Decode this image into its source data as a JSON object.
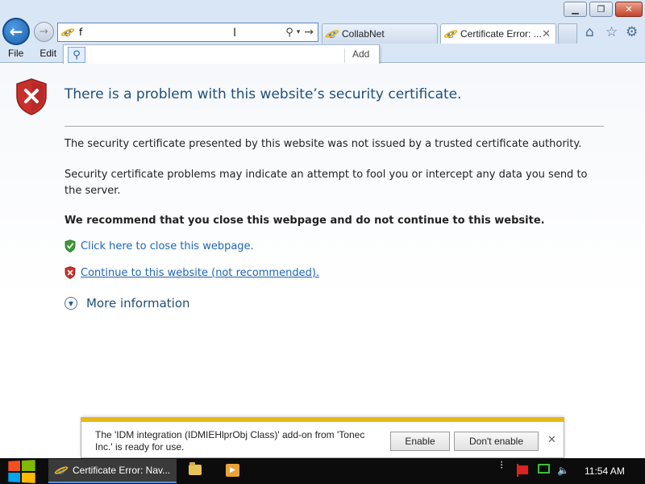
{
  "window": {
    "minimize_glyph": "▁",
    "maximize_glyph": "❐",
    "close_glyph": "✕"
  },
  "nav": {
    "back_glyph": "←",
    "forward_glyph": "→"
  },
  "address_bar": {
    "value": "f",
    "search_glyph": "⚲",
    "dropdown_glyph": "▾",
    "go_glyph": "→",
    "cursor_glyph": "I"
  },
  "tabs": [
    {
      "label": "CollabNet",
      "icon": "ie-icon"
    },
    {
      "label": "Certificate Error: ...",
      "icon": "ie-icon",
      "close_glyph": "✕"
    }
  ],
  "toolbar_icons": {
    "home_glyph": "⌂",
    "favorites_glyph": "☆",
    "tools_glyph": "⚙"
  },
  "menu": [
    "File",
    "Edit"
  ],
  "suggestion": {
    "search_glyph": "⚲",
    "add_label": "Add"
  },
  "page": {
    "headline": "There is a problem with this website’s security certificate.",
    "para1": "The security certificate presented by this website was not issued by a trusted certificate authority.",
    "para2": "Security certificate problems may indicate an attempt to fool you or intercept any data you send to the server.",
    "recommend": "We recommend that you close this webpage and do not continue to this website.",
    "close_link": "Click here to close this webpage.",
    "continue_link": "Continue to this website (not recommended).",
    "more_info": "More information"
  },
  "notification": {
    "message": "The 'IDM integration (IDMIEHlprObj Class)' add-on from 'Tonec Inc.' is ready for use.",
    "enable_label": "Enable",
    "dont_enable_label": "Don't enable",
    "close_glyph": "✕"
  },
  "taskbar": {
    "ie_task_label": "Certificate Error: Nav...",
    "media_glyph": "▶",
    "tray_dots": "⁝",
    "speaker_glyph": "🔈",
    "clock": "11:54 AM"
  },
  "colors": {
    "error_red": "#c9302c",
    "ok_green": "#3c9a3c",
    "link_blue": "#1f66b4",
    "notify_yellow": "#e8b617"
  }
}
